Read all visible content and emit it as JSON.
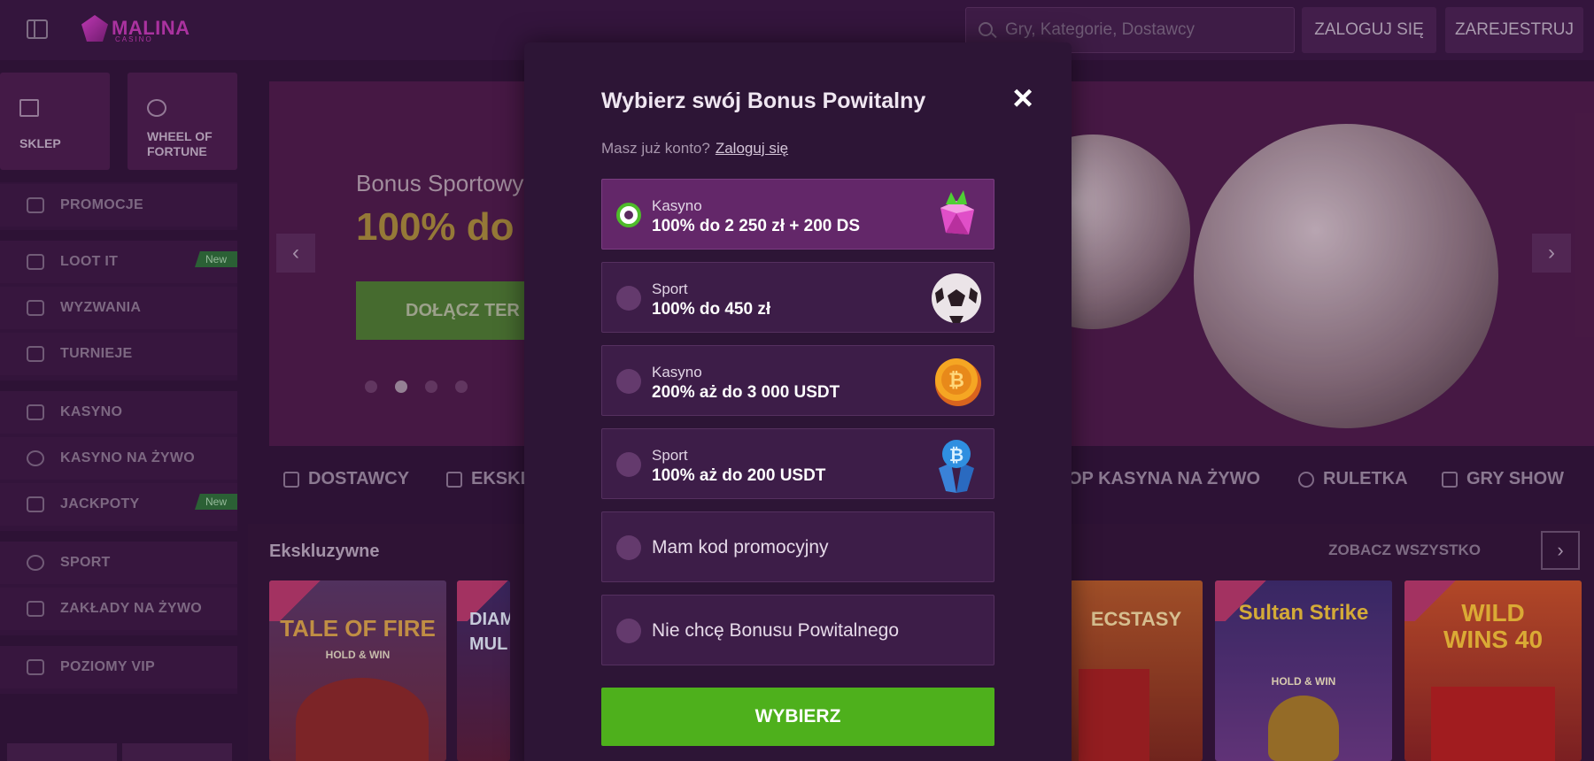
{
  "header": {
    "logo_text": "MALINA",
    "logo_sub": "CASINO",
    "search_placeholder": "Gry, Kategorie, Dostawcy",
    "login_label": "ZALOGUJ SIĘ",
    "register_label": "ZAREJESTRUJ"
  },
  "sidebar": {
    "tiles": [
      {
        "label": "SKLEP",
        "icon": "shop-icon"
      },
      {
        "label": "WHEEL OF FORTUNE",
        "icon": "wheel-icon"
      }
    ],
    "items": [
      {
        "label": "PROMOCJE",
        "icon": "gift-icon"
      },
      {
        "label": "LOOT IT",
        "icon": "box-icon",
        "badge": "New"
      },
      {
        "label": "WYZWANIA",
        "icon": "badge-icon"
      },
      {
        "label": "TURNIEJE",
        "icon": "trophy-icon"
      },
      {
        "label": "KASYNO",
        "icon": "cherry-icon"
      },
      {
        "label": "KASYNO NA ŻYWO",
        "icon": "chip-icon"
      },
      {
        "label": "JACKPOTY",
        "icon": "jackpot-icon",
        "badge": "New"
      },
      {
        "label": "SPORT",
        "icon": "football-icon"
      },
      {
        "label": "ZAKŁADY NA ŻYWO",
        "icon": "live-icon"
      },
      {
        "label": "POZIOMY VIP",
        "icon": "diamond-icon"
      }
    ]
  },
  "hero": {
    "line1": "Bonus Sportowy",
    "line2": "100% do",
    "cta": "DOŁĄCZ TER",
    "active_dot": 2
  },
  "categories": [
    "DOSTAWCY",
    "EKSKL",
    "OP KASYNA NA ŻYWO",
    "RULETKA",
    "GRY SHOW"
  ],
  "section": {
    "title": "Ekskluzywne",
    "see_all": "ZOBACZ WSZYSTKO",
    "games": [
      {
        "title": "TALE OF FIRE",
        "sub": "HOLD & WIN"
      },
      {
        "title": "DIAMO MUL",
        "sub": ""
      },
      {
        "title": "ECSTASY",
        "sub": ""
      },
      {
        "title": "Sultan Strike",
        "sub": "HOLD & WIN"
      },
      {
        "title": "WILD WINS 40",
        "sub": ""
      }
    ]
  },
  "modal": {
    "title": "Wybierz swój Bonus Powitalny",
    "sub_text": "Masz już konto?",
    "sub_link": "Zaloguj się",
    "options": [
      {
        "type": "Kasyno",
        "value": "100% do 2 250 zł + 200 DS",
        "selected": true,
        "icon": "gem-icon"
      },
      {
        "type": "Sport",
        "value": "100% do 450 zł",
        "selected": false,
        "icon": "football-icon"
      },
      {
        "type": "Kasyno",
        "value": "200% aż do 3 000 USDT",
        "selected": false,
        "icon": "bitcoin-coin-icon"
      },
      {
        "type": "Sport",
        "value": "100% aż do 200 USDT",
        "selected": false,
        "icon": "bitcoin-crystal-icon"
      }
    ],
    "promo_code": "Mam kod promocyjny",
    "no_bonus": "Nie chcę Bonusu Powitalnego",
    "submit": "WYBIERZ"
  }
}
